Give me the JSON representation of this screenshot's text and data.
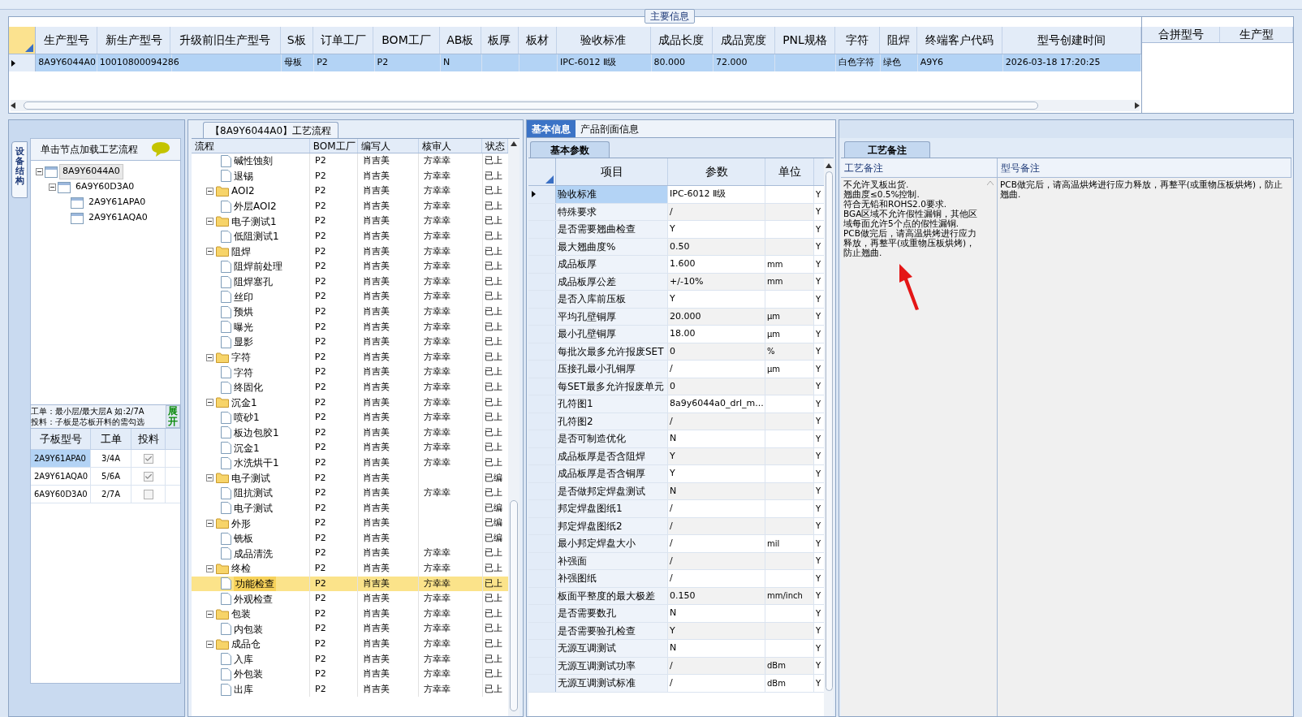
{
  "main_info": {
    "title": "主要信息",
    "columns": [
      "生产型号",
      "新生产型号",
      "升级前旧生产型号",
      "S板",
      "订单工厂",
      "BOM工厂",
      "AB板",
      "板厚",
      "板材",
      "验收标准",
      "成品长度",
      "成品宽度",
      "PNL规格",
      "字符",
      "阻焊",
      "终端客户代码",
      "型号创建时间"
    ],
    "rows": [
      {
        "selected": true,
        "cells": [
          "8A9Y6044A0",
          "10010800094286",
          null,
          "母板",
          "P2",
          "P2",
          "N",
          null,
          null,
          "IPC-6012 Ⅱ级",
          "80.000",
          "72.000",
          null,
          "白色字符",
          "绿色",
          "A9Y6",
          "2026-03-18 17:20:25"
        ]
      }
    ],
    "merge_columns": [
      "合拼型号",
      "生产型"
    ]
  },
  "left_panel": {
    "tab": "设备结构",
    "header": "单击节点加载工艺流程",
    "tree": [
      {
        "label": "8A9Y6044A0",
        "expanded": true,
        "selected": true,
        "children": [
          {
            "label": "6A9Y60D3A0",
            "expanded": true,
            "selected": false,
            "children": [
              {
                "label": "2A9Y61APA0",
                "selected": false
              },
              {
                "label": "2A9Y61AQA0",
                "selected": false
              }
            ]
          }
        ]
      }
    ],
    "hint_lines": [
      "工单：最小层/最大层A 如:2/7A",
      "投料：子板是芯板开料的需勾选"
    ],
    "expand_button": "展开",
    "sub_boards": {
      "columns": [
        "子板型号",
        "工单",
        "投料"
      ],
      "rows": [
        {
          "model": "2A9Y61APA0",
          "order": "3/4A",
          "feed": true,
          "selected": true
        },
        {
          "model": "2A9Y61AQA0",
          "order": "5/6A",
          "feed": true,
          "selected": false
        },
        {
          "model": "6A9Y60D3A0",
          "order": "2/7A",
          "feed": false,
          "selected": false
        }
      ]
    }
  },
  "process": {
    "title": "【8A9Y6044A0】工艺流程",
    "columns": [
      "流程",
      "BOM工厂",
      "编写人",
      "核审人",
      "状态"
    ],
    "rows": [
      {
        "kind": "group-tail",
        "children": [
          {
            "name": "碱性蚀刻",
            "bom": "P2",
            "author": "肖吉美",
            "reviewer": "方幸幸",
            "status": "已上",
            "selected": false
          },
          {
            "name": "退锡",
            "bom": "P2",
            "author": "肖吉美",
            "reviewer": "方幸幸",
            "status": "已上",
            "selected": false
          }
        ]
      },
      {
        "kind": "group",
        "name": "AOI2",
        "bom": "P2",
        "author": "肖吉美",
        "reviewer": "方幸幸",
        "status": "已上",
        "selected": false,
        "expanded": true,
        "children": [
          {
            "name": "外层AOI2",
            "bom": "P2",
            "author": "肖吉美",
            "reviewer": "方幸幸",
            "status": "已上",
            "selected": false
          }
        ]
      },
      {
        "kind": "group",
        "name": "电子测试1",
        "bom": "P2",
        "author": "肖吉美",
        "reviewer": "方幸幸",
        "status": "已上",
        "selected": false,
        "expanded": true,
        "children": [
          {
            "name": "低阻测试1",
            "bom": "P2",
            "author": "肖吉美",
            "reviewer": "方幸幸",
            "status": "已上",
            "selected": false
          }
        ]
      },
      {
        "kind": "group",
        "name": "阻焊",
        "bom": "P2",
        "author": "肖吉美",
        "reviewer": "方幸幸",
        "status": "已上",
        "selected": false,
        "expanded": true,
        "children": [
          {
            "name": "阻焊前处理",
            "bom": "P2",
            "author": "肖吉美",
            "reviewer": "方幸幸",
            "status": "已上",
            "selected": false
          },
          {
            "name": "阻焊塞孔",
            "bom": "P2",
            "author": "肖吉美",
            "reviewer": "方幸幸",
            "status": "已上",
            "selected": false
          },
          {
            "name": "丝印",
            "bom": "P2",
            "author": "肖吉美",
            "reviewer": "方幸幸",
            "status": "已上",
            "selected": false
          },
          {
            "name": "预烘",
            "bom": "P2",
            "author": "肖吉美",
            "reviewer": "方幸幸",
            "status": "已上",
            "selected": false
          },
          {
            "name": "曝光",
            "bom": "P2",
            "author": "肖吉美",
            "reviewer": "方幸幸",
            "status": "已上",
            "selected": false
          },
          {
            "name": "显影",
            "bom": "P2",
            "author": "肖吉美",
            "reviewer": "方幸幸",
            "status": "已上",
            "selected": false
          }
        ]
      },
      {
        "kind": "group",
        "name": "字符",
        "bom": "P2",
        "author": "肖吉美",
        "reviewer": "方幸幸",
        "status": "已上",
        "selected": false,
        "expanded": true,
        "children": [
          {
            "name": "字符",
            "bom": "P2",
            "author": "肖吉美",
            "reviewer": "方幸幸",
            "status": "已上",
            "selected": false
          },
          {
            "name": "终固化",
            "bom": "P2",
            "author": "肖吉美",
            "reviewer": "方幸幸",
            "status": "已上",
            "selected": false
          }
        ]
      },
      {
        "kind": "group",
        "name": "沉金1",
        "bom": "P2",
        "author": "肖吉美",
        "reviewer": "方幸幸",
        "status": "已上",
        "selected": false,
        "expanded": true,
        "children": [
          {
            "name": "喷砂1",
            "bom": "P2",
            "author": "肖吉美",
            "reviewer": "方幸幸",
            "status": "已上",
            "selected": false
          },
          {
            "name": "板边包胶1",
            "bom": "P2",
            "author": "肖吉美",
            "reviewer": "方幸幸",
            "status": "已上",
            "selected": false
          },
          {
            "name": "沉金1",
            "bom": "P2",
            "author": "肖吉美",
            "reviewer": "方幸幸",
            "status": "已上",
            "selected": false
          },
          {
            "name": "水洗烘干1",
            "bom": "P2",
            "author": "肖吉美",
            "reviewer": "方幸幸",
            "status": "已上",
            "selected": false
          }
        ]
      },
      {
        "kind": "group",
        "name": "电子测试",
        "bom": "P2",
        "author": "肖吉美",
        "status": "已编",
        "selected": false,
        "expanded": true,
        "children": [
          {
            "name": "阻抗测试",
            "bom": "P2",
            "author": "肖吉美",
            "reviewer": "方幸幸",
            "status": "已上",
            "selected": false
          },
          {
            "name": "电子测试",
            "bom": "P2",
            "author": "肖吉美",
            "status": "已编",
            "selected": false
          }
        ]
      },
      {
        "kind": "group",
        "name": "外形",
        "bom": "P2",
        "author": "肖吉美",
        "status": "已编",
        "selected": false,
        "expanded": true,
        "children": [
          {
            "name": "铣板",
            "bom": "P2",
            "author": "肖吉美",
            "status": "已编",
            "selected": false
          },
          {
            "name": "成品清洗",
            "bom": "P2",
            "author": "肖吉美",
            "reviewer": "方幸幸",
            "status": "已上",
            "selected": false
          }
        ]
      },
      {
        "kind": "group",
        "name": "终检",
        "bom": "P2",
        "author": "肖吉美",
        "reviewer": "方幸幸",
        "status": "已上",
        "selected": false,
        "expanded": true,
        "children": [
          {
            "name": "功能检查",
            "bom": "P2",
            "author": "肖吉美",
            "reviewer": "方幸幸",
            "status": "已上",
            "selected": true
          },
          {
            "name": "外观检查",
            "bom": "P2",
            "author": "肖吉美",
            "reviewer": "方幸幸",
            "status": "已上",
            "selected": false
          }
        ]
      },
      {
        "kind": "group",
        "name": "包装",
        "bom": "P2",
        "author": "肖吉美",
        "reviewer": "方幸幸",
        "status": "已上",
        "selected": false,
        "expanded": true,
        "children": [
          {
            "name": "内包装",
            "bom": "P2",
            "author": "肖吉美",
            "reviewer": "方幸幸",
            "status": "已上",
            "selected": false
          }
        ]
      },
      {
        "kind": "group",
        "name": "成品仓",
        "bom": "P2",
        "author": "肖吉美",
        "reviewer": "方幸幸",
        "status": "已上",
        "selected": false,
        "expanded": true,
        "children": [
          {
            "name": "入库",
            "bom": "P2",
            "author": "肖吉美",
            "reviewer": "方幸幸",
            "status": "已上",
            "selected": false
          },
          {
            "name": "外包装",
            "bom": "P2",
            "author": "肖吉美",
            "reviewer": "方幸幸",
            "status": "已上",
            "selected": false
          },
          {
            "name": "出库",
            "bom": "P2",
            "author": "肖吉美",
            "reviewer": "方幸幸",
            "status": "已上",
            "selected": false
          }
        ]
      }
    ]
  },
  "params": {
    "tabs": [
      {
        "label": "基本信息",
        "selected": true
      },
      {
        "label": "产品剖面信息",
        "selected": false
      }
    ],
    "subtab": "基本参数",
    "columns": [
      "项目",
      "参数",
      "单位"
    ],
    "rows": [
      {
        "item": "验收标准",
        "value": "IPC-6012 Ⅱ级",
        "flag": "Y",
        "selected": true
      },
      {
        "item": "特殊要求",
        "value": "/",
        "flag": "Y",
        "selected": false
      },
      {
        "item": "是否需要翘曲检查",
        "value": "Y",
        "flag": "Y",
        "selected": false
      },
      {
        "item": "最大翘曲度%",
        "value": "0.50",
        "flag": "Y",
        "selected": false
      },
      {
        "item": "成品板厚",
        "value": "1.600",
        "unit": "mm",
        "flag": "Y",
        "selected": false
      },
      {
        "item": "成品板厚公差",
        "value": "+/-10%",
        "unit": "mm",
        "flag": "Y",
        "selected": false
      },
      {
        "item": "是否入库前压板",
        "value": "Y",
        "flag": "Y",
        "selected": false
      },
      {
        "item": "平均孔壁铜厚",
        "value": "20.000",
        "unit": "μm",
        "flag": "Y",
        "selected": false
      },
      {
        "item": "最小孔壁铜厚",
        "value": "18.00",
        "unit": "μm",
        "flag": "Y",
        "selected": false
      },
      {
        "item": "每批次最多允许报废SET",
        "value": "0",
        "unit": "%",
        "flag": "Y",
        "selected": false
      },
      {
        "item": "压接孔最小孔铜厚",
        "value": "/",
        "unit": "μm",
        "flag": "Y",
        "selected": false
      },
      {
        "item": "每SET最多允许报废单元",
        "value": "0",
        "flag": "Y",
        "selected": false
      },
      {
        "item": "孔符图1",
        "value": "8a9y6044a0_drl_m...",
        "flag": "Y",
        "selected": false
      },
      {
        "item": "孔符图2",
        "value": "/",
        "flag": "Y",
        "selected": false
      },
      {
        "item": "是否可制造优化",
        "value": "N",
        "flag": "Y",
        "selected": false
      },
      {
        "item": "成品板厚是否含阻焊",
        "value": "Y",
        "flag": "Y",
        "selected": false
      },
      {
        "item": "成品板厚是否含铜厚",
        "value": "Y",
        "flag": "Y",
        "selected": false
      },
      {
        "item": "是否做邦定焊盘测试",
        "value": "N",
        "flag": "Y",
        "selected": false
      },
      {
        "item": "邦定焊盘图纸1",
        "value": "/",
        "flag": "Y",
        "selected": false
      },
      {
        "item": "邦定焊盘图纸2",
        "value": "/",
        "flag": "Y",
        "selected": false
      },
      {
        "item": "最小邦定焊盘大小",
        "value": "/",
        "unit": "mil",
        "flag": "Y",
        "selected": false
      },
      {
        "item": "补强面",
        "value": "/",
        "flag": "Y",
        "selected": false
      },
      {
        "item": "补强图纸",
        "value": "/",
        "flag": "Y",
        "selected": false
      },
      {
        "item": "板面平整度的最大极差",
        "value": "0.150",
        "unit": "mm/inch",
        "flag": "Y",
        "selected": false
      },
      {
        "item": "是否需要数孔",
        "value": "N",
        "flag": "Y",
        "selected": false
      },
      {
        "item": "是否需要验孔检查",
        "value": "Y",
        "flag": "Y",
        "selected": false
      },
      {
        "item": "无源互调测试",
        "value": "N",
        "flag": "Y",
        "selected": false
      },
      {
        "item": "无源互调测试功率",
        "value": "/",
        "unit": "dBm",
        "flag": "Y",
        "selected": false
      },
      {
        "item": "无源互调测试标准",
        "value": "/",
        "unit": "dBm",
        "flag": "Y",
        "selected": false
      }
    ]
  },
  "notes": {
    "tab": "工艺备注",
    "columns": [
      "工艺备注",
      "型号备注"
    ],
    "process_note": "不允许叉板出货.\n翘曲度≤0.5%控制.\n符合无铅和ROHS2.0要求.\nBGA区域不允许假性漏铜，其他区域每面允许5个点的假性漏铜.\nPCB做完后，请高温烘烤进行应力释放，再整平(或重物压板烘烤)，防止翘曲.",
    "model_note": "PCB做完后，请高温烘烤进行应力释放，再整平(或重物压板烘烤)，防止翘曲."
  }
}
